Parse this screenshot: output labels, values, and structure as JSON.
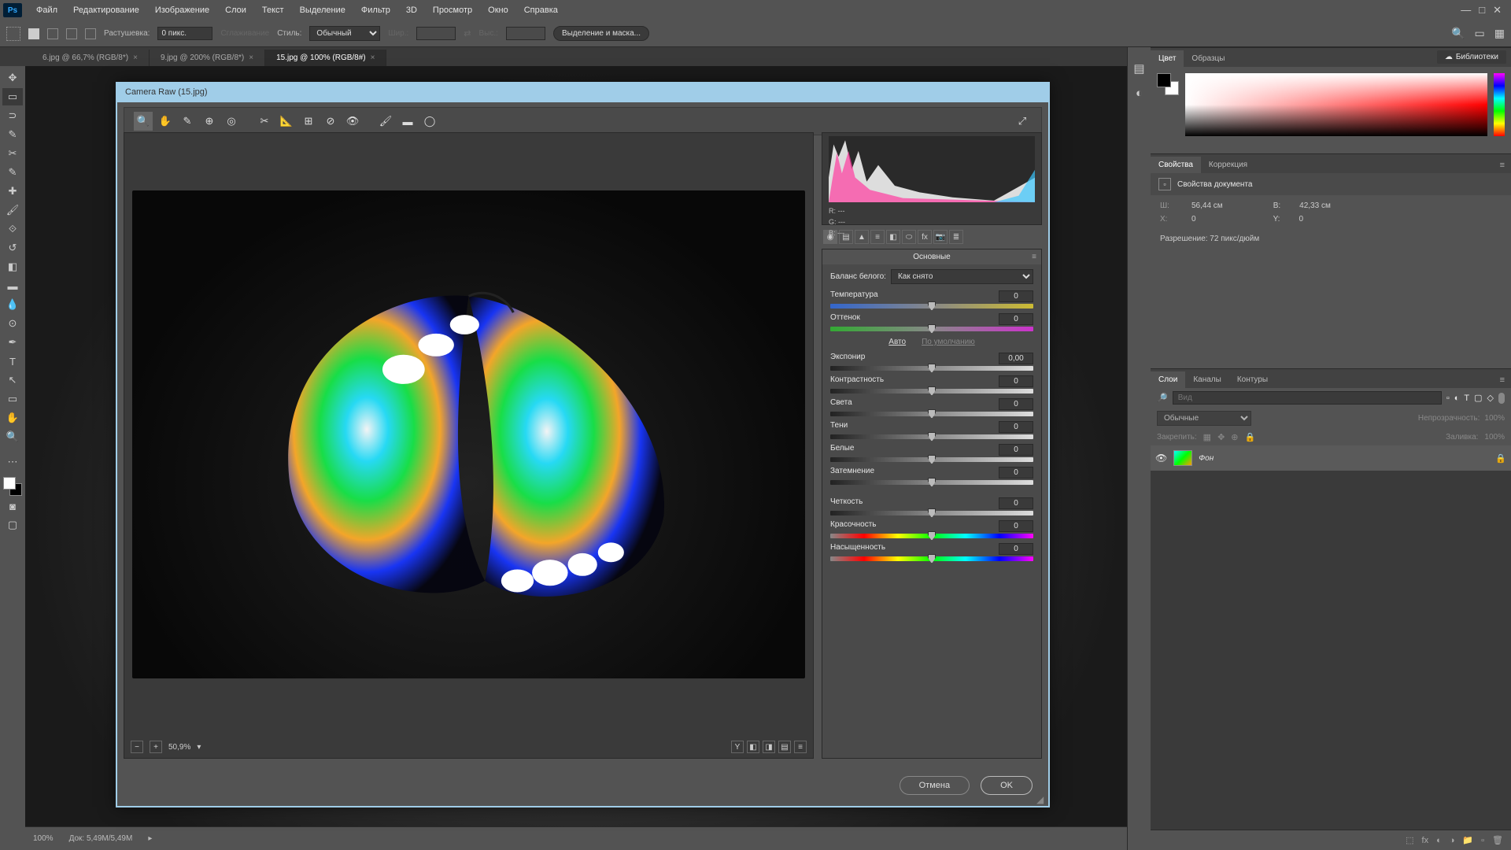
{
  "app": {
    "logo": "Ps"
  },
  "menu": [
    "Файл",
    "Редактирование",
    "Изображение",
    "Слои",
    "Текст",
    "Выделение",
    "Фильтр",
    "3D",
    "Просмотр",
    "Окно",
    "Справка"
  ],
  "optbar": {
    "feather_label": "Растушевка:",
    "feather_value": "0 пикс.",
    "antialias_label": "Сглаживание",
    "style_label": "Стиль:",
    "style_value": "Обычный",
    "width_label": "Шир.:",
    "height_label": "Выс.:",
    "select_mask": "Выделение и маска..."
  },
  "tabs": [
    {
      "label": "6.jpg @ 66,7% (RGB/8*)",
      "active": false
    },
    {
      "label": "9.jpg @ 200% (RGB/8*)",
      "active": false
    },
    {
      "label": "15.jpg @ 100% (RGB/8#)",
      "active": true
    }
  ],
  "lib_tab": "Библиотеки",
  "color_tabs": {
    "color": "Цвет",
    "swatches": "Образцы"
  },
  "props": {
    "tab_props": "Свойства",
    "tab_corr": "Коррекция",
    "doc_props": "Свойства документа",
    "w_label": "Ш:",
    "w_val": "56,44 см",
    "h_label": "В:",
    "h_val": "42,33 см",
    "x_label": "X:",
    "x_val": "0",
    "y_label": "Y:",
    "y_val": "0",
    "res": "Разрешение: 72 пикс/дюйм"
  },
  "layers": {
    "tab_layers": "Слои",
    "tab_channels": "Каналы",
    "tab_paths": "Контуры",
    "search_ph": "Вид",
    "blend": "Обычные",
    "opacity_label": "Непрозрачность:",
    "opacity_val": "100%",
    "lock_label": "Закрепить:",
    "fill_label": "Заливка:",
    "fill_val": "100%",
    "layer_name": "Фон"
  },
  "status": {
    "zoom": "100%",
    "doc": "Док: 5,49M/5,49M"
  },
  "cr": {
    "title": "Camera Raw (15.jpg)",
    "zoom": "50,9%",
    "rgb": {
      "r_label": "R:",
      "g_label": "G:",
      "b_label": "B:",
      "dash": "---"
    },
    "panel_title": "Основные",
    "wb_label": "Баланс белого:",
    "wb_value": "Как снято",
    "auto": "Авто",
    "default": "По умолчанию",
    "sliders": {
      "temperature": {
        "label": "Температура",
        "value": "0"
      },
      "tint": {
        "label": "Оттенок",
        "value": "0"
      },
      "exposure": {
        "label": "Экспонир",
        "value": "0,00"
      },
      "contrast": {
        "label": "Контрастность",
        "value": "0"
      },
      "highlights": {
        "label": "Света",
        "value": "0"
      },
      "shadows": {
        "label": "Тени",
        "value": "0"
      },
      "whites": {
        "label": "Белые",
        "value": "0"
      },
      "blacks": {
        "label": "Затемнение",
        "value": "0"
      },
      "clarity": {
        "label": "Четкость",
        "value": "0"
      },
      "vibrance": {
        "label": "Красочность",
        "value": "0"
      },
      "saturation": {
        "label": "Насыщенность",
        "value": "0"
      }
    },
    "cancel": "Отмена",
    "ok": "OK"
  }
}
